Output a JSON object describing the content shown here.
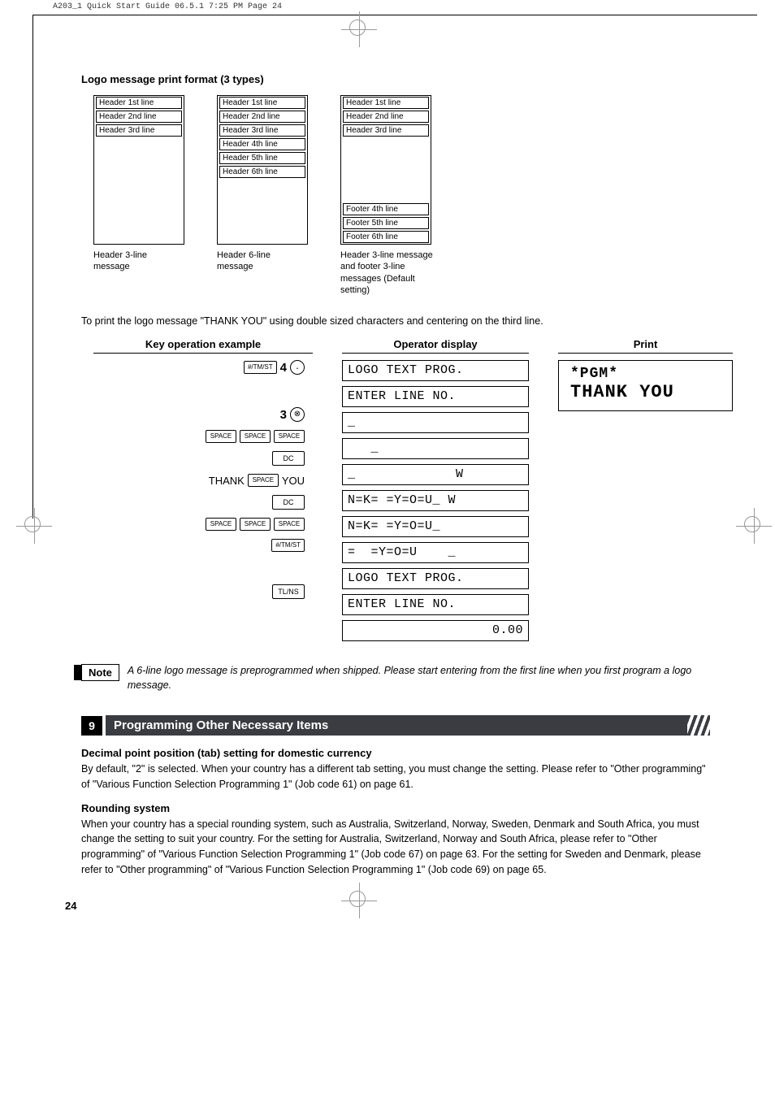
{
  "header_line": "A203_1 Quick Start Guide  06.5.1 7:25 PM  Page 24",
  "title1": "Logo message print format (3 types)",
  "formats": {
    "col1": {
      "lines": [
        "Header 1st line",
        "Header 2nd line",
        "Header 3rd line"
      ],
      "caption": "Header 3-line message"
    },
    "col2": {
      "lines": [
        "Header 1st line",
        "Header 2nd line",
        "Header 3rd line",
        "Header 4th line",
        "Header 5th line",
        "Header 6th line"
      ],
      "caption": "Header 6-line message"
    },
    "col3": {
      "header_lines": [
        "Header 1st line",
        "Header 2nd line",
        "Header 3rd line"
      ],
      "footer_lines": [
        "Footer 4th line",
        "Footer 5th line",
        "Footer 6th line"
      ],
      "caption": "Header 3-line message and footer 3-line messages (Default setting)"
    }
  },
  "intro": "To print the logo message \"THANK YOU\" using double sized characters and centering on the third line.",
  "columns": {
    "key": "Key operation example",
    "display": "Operator display",
    "print": "Print"
  },
  "keys": {
    "tmst": "#/TM/ST",
    "space": "SPACE",
    "dc": "DC",
    "tlns": "TL/NS",
    "dot": "·",
    "x": "⊗",
    "thank": "THANK",
    "you": "YOU",
    "four": "4",
    "three": "3"
  },
  "lcd": [
    "LOGO TEXT PROG.",
    "ENTER LINE NO.",
    "_",
    "   _",
    "_             W",
    "N=K= =Y=O=U_ W",
    "N=K= =Y=O=U_",
    "=  =Y=O=U    _",
    "LOGO TEXT PROG.",
    "ENTER LINE NO.",
    "           0.00"
  ],
  "print_lines": {
    "pgm": "*PGM*",
    "thank": " THANK YOU"
  },
  "note_label": "Note",
  "note_text": "A 6-line logo message is preprogrammed when shipped.  Please start entering from the first line when you first program a logo message.",
  "section": {
    "num": "9",
    "title": "Programming Other Necessary Items"
  },
  "sub1_title": "Decimal point position (tab) setting for domestic currency",
  "sub1_text": "By default, \"2\" is selected.  When your country has a different tab setting, you must change the setting.  Please refer to \"Other programming\" of \"Various Function Selection Programming 1\" (Job code 61) on page 61.",
  "sub2_title": "Rounding system",
  "sub2_text": "When your country has a special rounding system, such as Australia, Switzerland, Norway, Sweden, Denmark and South Africa, you must change the setting to suit your country. For the setting for Australia, Switzerland, Norway and South Africa, please refer to \"Other programming\" of \"Various Function Selection Programming 1\" (Job code 67) on page 63.  For the setting for Sweden and Denmark, please refer to \"Other programming\" of \"Various Function Selection Programming 1\" (Job code 69) on page 65.",
  "page_num": "24"
}
